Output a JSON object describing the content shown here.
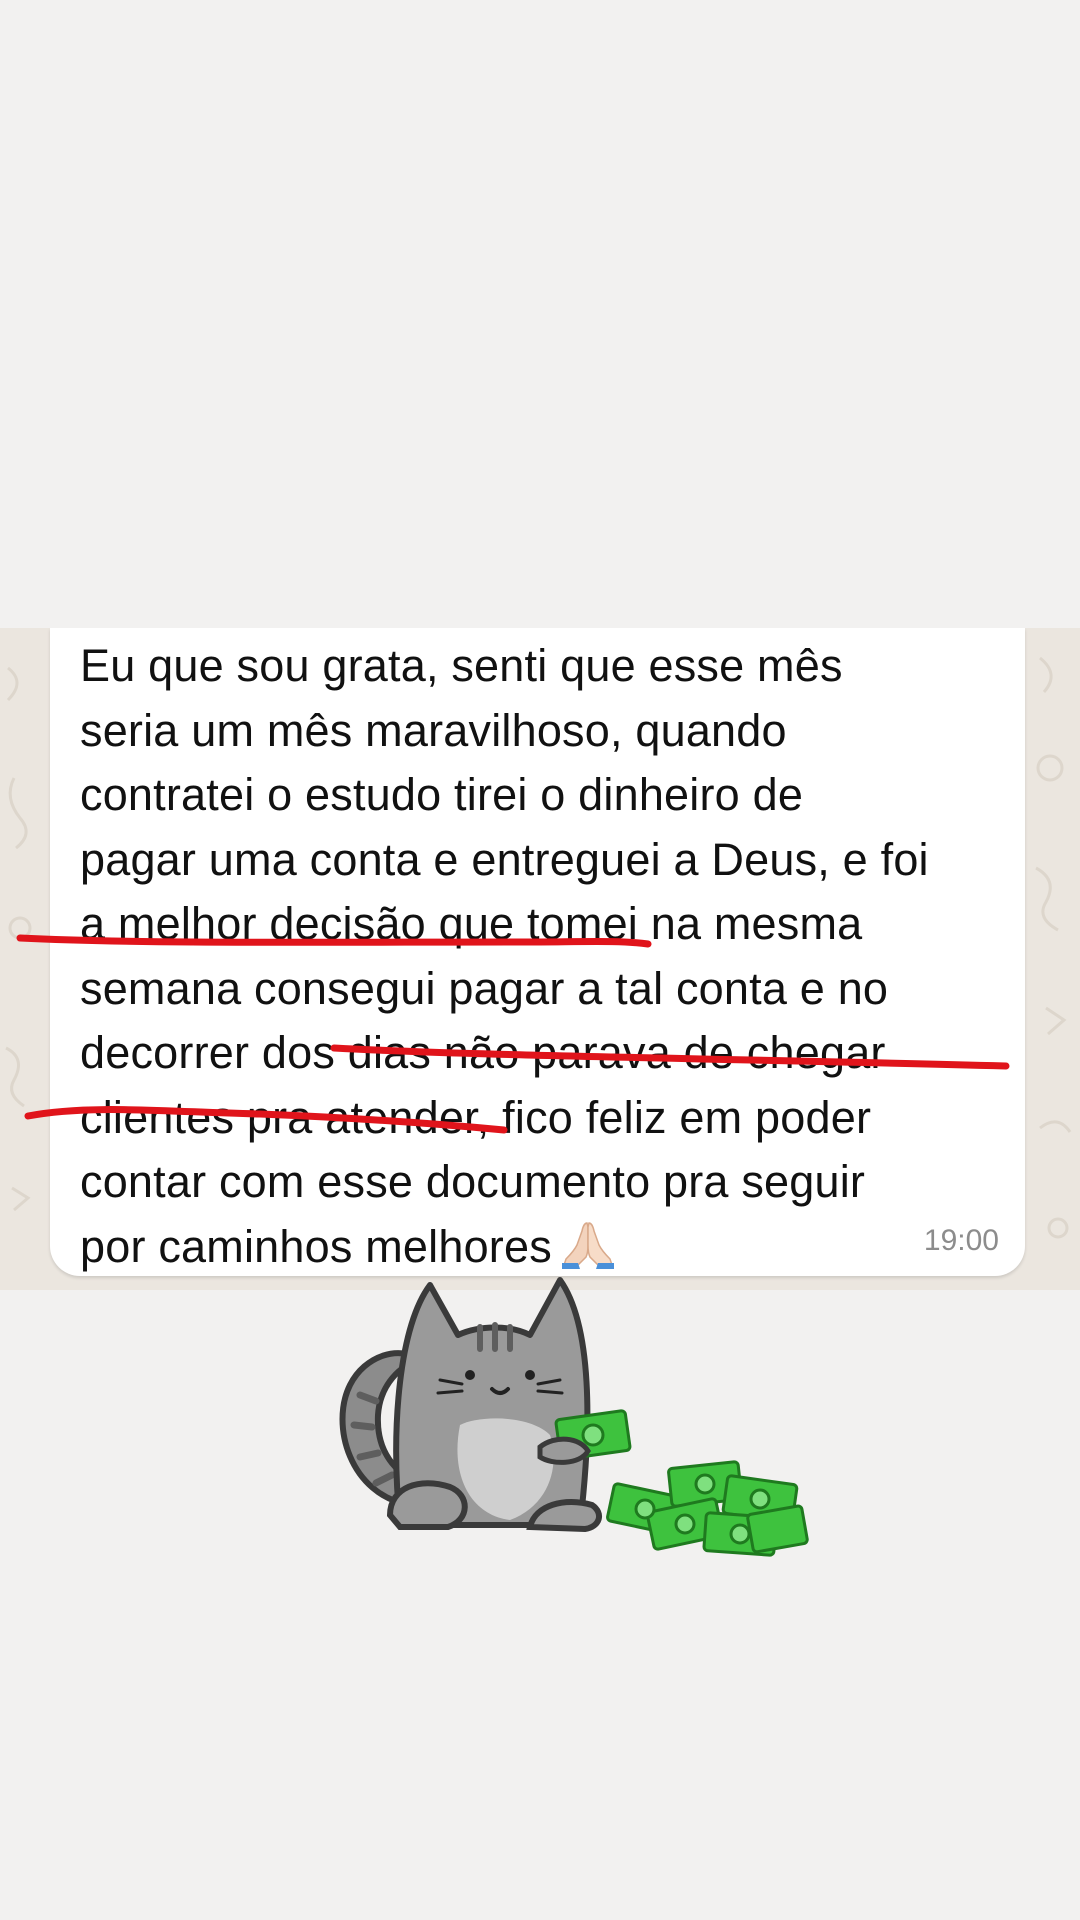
{
  "message": {
    "lines": [
      "Eu que sou grata, senti que esse mês",
      "seria um mês maravilhoso, quando",
      "contratei o estudo tirei o dinheiro de",
      "pagar uma conta e entreguei a Deus, e foi",
      "a melhor decisão que tomei na mesma",
      "semana consegui pagar a tal conta e no",
      "decorrer dos dias não parava de chegar",
      "clientes pra atender, fico feliz em poder",
      "contar com esse documento pra seguir",
      "por caminhos melhores"
    ],
    "emoji": "🙏🏻",
    "time": "19:00"
  },
  "annotation": {
    "underline_color": "#e0141b"
  },
  "sticker": {
    "name": "cat-with-money-sticker",
    "money_symbol": "$"
  }
}
